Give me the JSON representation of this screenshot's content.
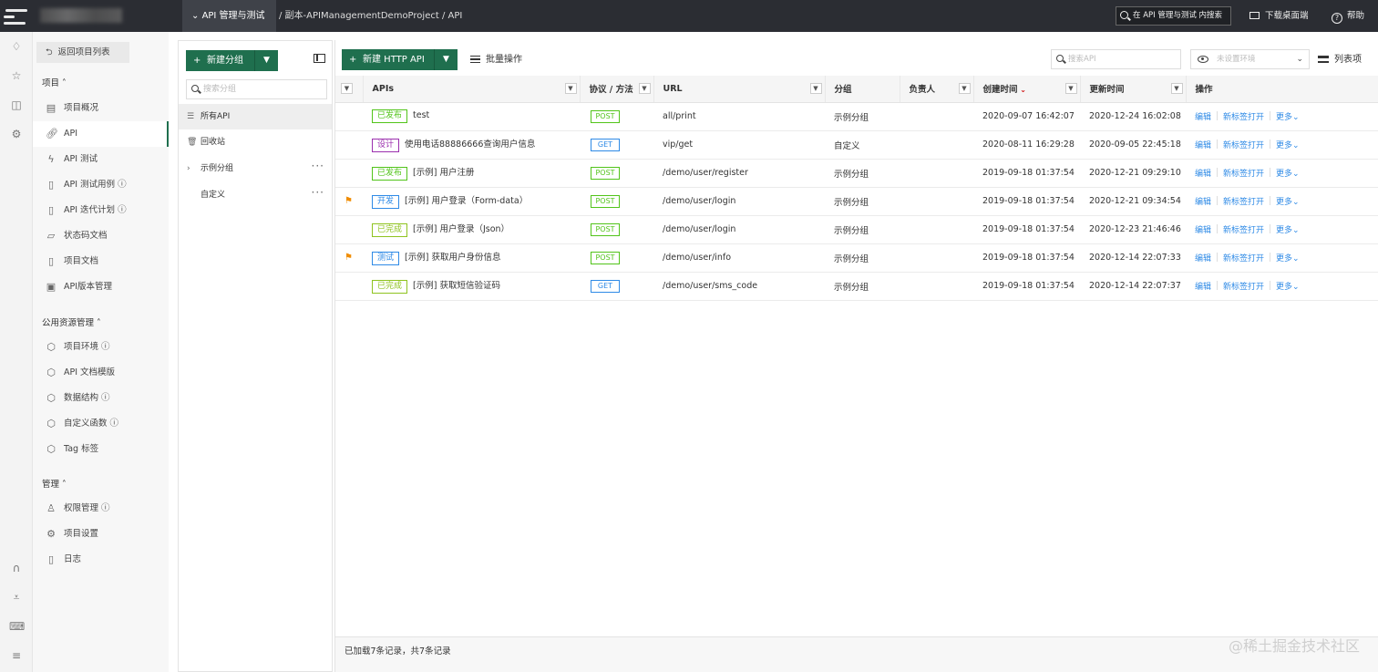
{
  "topbar": {
    "project_tab": "API 管理与测试",
    "breadcrumb": "/ 副本-APIManagementDemoProject / API",
    "search_placeholder": "在 API 管理与测试 内搜索",
    "download_label": "下载桌面端",
    "help_label": "帮助"
  },
  "nav": {
    "back_label": "返回项目列表",
    "group_project": "项目",
    "project_items": [
      "项目概况",
      "API",
      "API 测试",
      "API 测试用例",
      "API 迭代计划",
      "状态码文档",
      "项目文档",
      "API版本管理"
    ],
    "group_public": "公用资源管理",
    "public_items": [
      "项目环境",
      "API 文档模版",
      "数据结构",
      "自定义函数",
      "Tag 标签"
    ],
    "group_manage": "管理",
    "manage_items": [
      "权限管理",
      "项目设置",
      "日志"
    ]
  },
  "groups": {
    "new_group_label": "新建分组",
    "search_placeholder": "搜索分组",
    "items": [
      "所有API",
      "回收站",
      "示例分组",
      "自定义"
    ]
  },
  "toolbar": {
    "new_api_label": "新建 HTTP API",
    "batch_label": "批量操作",
    "search_placeholder": "搜索API",
    "env_placeholder": "未设置环境",
    "list_view_label": "列表项"
  },
  "table": {
    "headers": [
      "APIs",
      "协议 / 方法",
      "URL",
      "分组",
      "负责人",
      "创建时间",
      "更新时间",
      "操作"
    ],
    "rows": [
      {
        "flag": "",
        "status": "已发布",
        "name": "test",
        "method": "POST",
        "url": "all/print",
        "group": "示例分组",
        "owner": "",
        "created": "2020-09-07 16:42:07",
        "updated": "2020-12-24 16:02:08"
      },
      {
        "flag": "",
        "status": "设计",
        "name": "使用电话88886666查询用户信息",
        "method": "GET",
        "url": "vip/get",
        "group": "自定义",
        "owner": "",
        "created": "2020-08-11 16:29:28",
        "updated": "2020-09-05 22:45:18"
      },
      {
        "flag": "",
        "status": "已发布",
        "name": "[示例] 用户注册",
        "method": "POST",
        "url": "/demo/user/register",
        "group": "示例分组",
        "owner": "",
        "created": "2019-09-18 01:37:54",
        "updated": "2020-12-21 09:29:10"
      },
      {
        "flag": "⚑",
        "status": "开发",
        "name": "[示例] 用户登录（Form-data）",
        "method": "POST",
        "url": "/demo/user/login",
        "group": "示例分组",
        "owner": "",
        "created": "2019-09-18 01:37:54",
        "updated": "2020-12-21 09:34:54"
      },
      {
        "flag": "",
        "status": "已完成",
        "name": "[示例] 用户登录（Json）",
        "method": "POST",
        "url": "/demo/user/login",
        "group": "示例分组",
        "owner": "",
        "created": "2019-09-18 01:37:54",
        "updated": "2020-12-23 21:46:46"
      },
      {
        "flag": "⚑",
        "status": "测试",
        "name": "[示例] 获取用户身份信息",
        "method": "POST",
        "url": "/demo/user/info",
        "group": "示例分组",
        "owner": "",
        "created": "2019-09-18 01:37:54",
        "updated": "2020-12-14 22:07:33"
      },
      {
        "flag": "",
        "status": "已完成",
        "name": "[示例] 获取短信验证码",
        "method": "GET",
        "url": "/demo/user/sms_code",
        "group": "示例分组",
        "owner": "",
        "created": "2019-09-18 01:37:54",
        "updated": "2020-12-14 22:07:37"
      }
    ],
    "op_edit": "编辑",
    "op_open_tab": "新标签打开",
    "op_more": "更多"
  },
  "footer": {
    "status": "已加载7条记录，共7条记录"
  },
  "watermark": "@稀土掘金技术社区",
  "colors": {
    "accent": "#1f6f4e",
    "link": "#2e8ae6",
    "status_published": "#52c41a",
    "status_design": "#9b2fae",
    "status_dev": "#2e8ae6",
    "status_done": "#8fc31f",
    "status_test": "#2e8ae6",
    "method_post": "#52c41a",
    "method_get": "#2e8ae6"
  }
}
